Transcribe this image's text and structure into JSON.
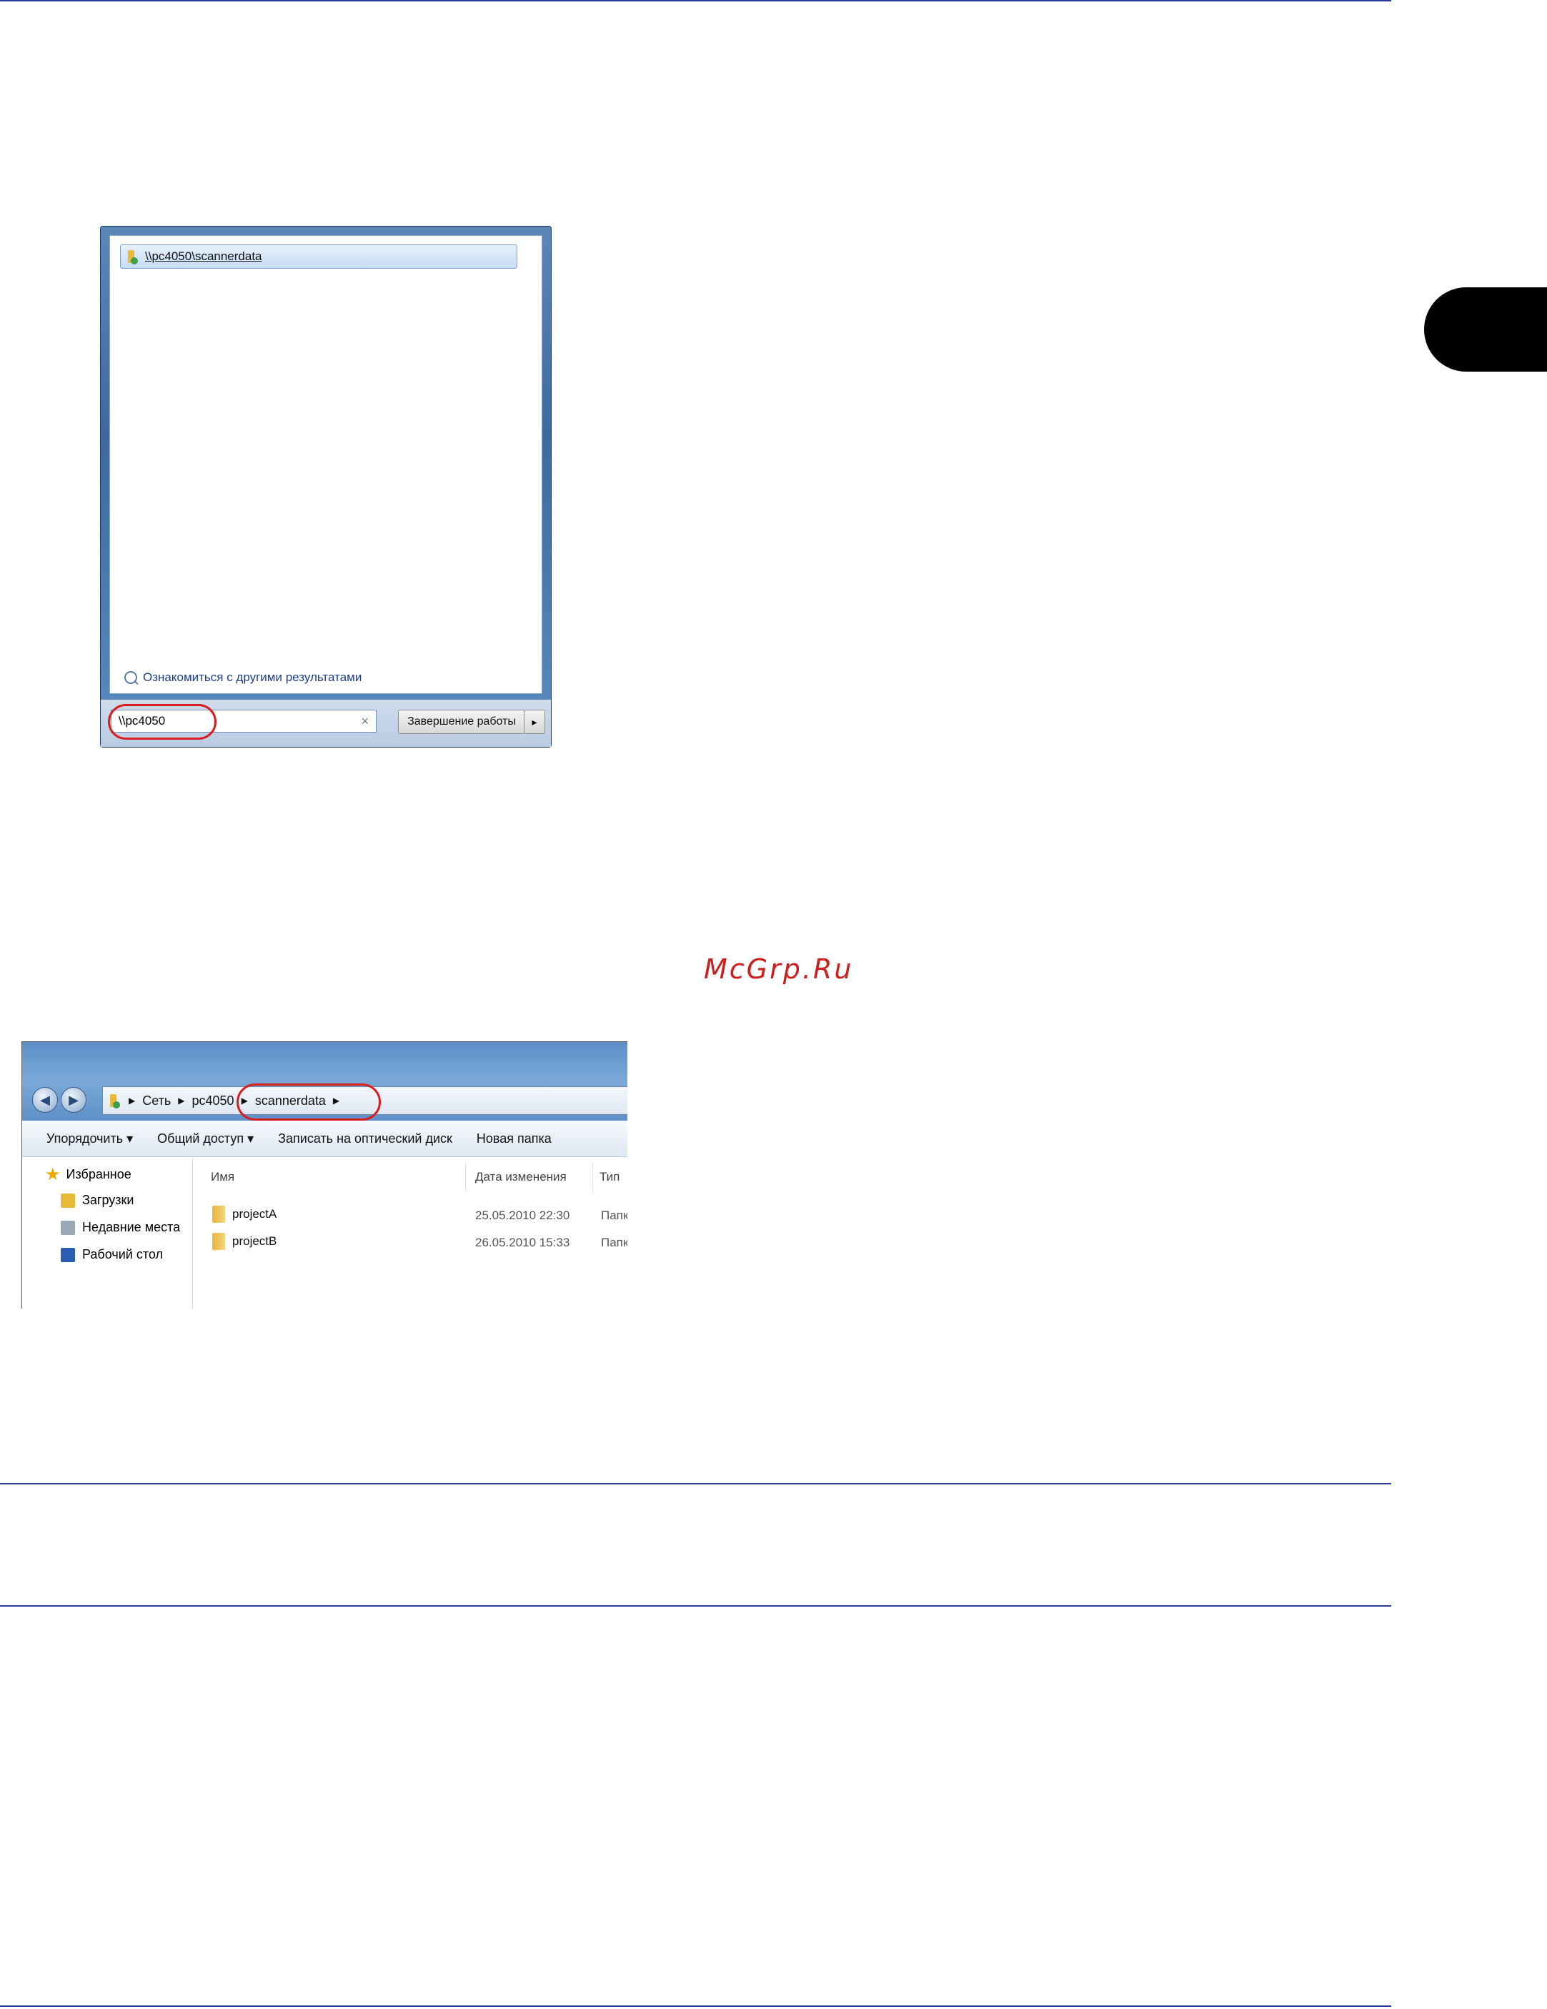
{
  "side_tab": "",
  "watermark": "McGrp.Ru",
  "start_menu": {
    "result_item": "\\\\pc4050\\scannerdata",
    "more_results": "Ознакомиться с другими результатами",
    "search_value": "\\\\pc4050",
    "clear_icon": "×",
    "shutdown_label": "Завершение работы",
    "shutdown_arrow": "▸"
  },
  "explorer": {
    "breadcrumb": [
      "Сеть",
      "pc4050",
      "scannerdata"
    ],
    "toolbar": {
      "organize": "Упорядочить ▾",
      "share": "Общий доступ ▾",
      "burn": "Записать на оптический диск",
      "new_folder": "Новая папка"
    },
    "nav": {
      "favorites": "Избранное",
      "downloads": "Загрузки",
      "recent": "Недавние места",
      "desktop": "Рабочий стол"
    },
    "columns": {
      "name": "Имя",
      "date": "Дата изменения",
      "type": "Тип"
    },
    "rows": [
      {
        "name": "projectA",
        "date": "25.05.2010 22:30",
        "type": "Папк"
      },
      {
        "name": "projectB",
        "date": "26.05.2010 15:33",
        "type": "Папк"
      }
    ]
  },
  "colors": {
    "rule": "#2a3a9a",
    "highlight": "#d91d1d",
    "watermark": "#cc1f1f"
  }
}
